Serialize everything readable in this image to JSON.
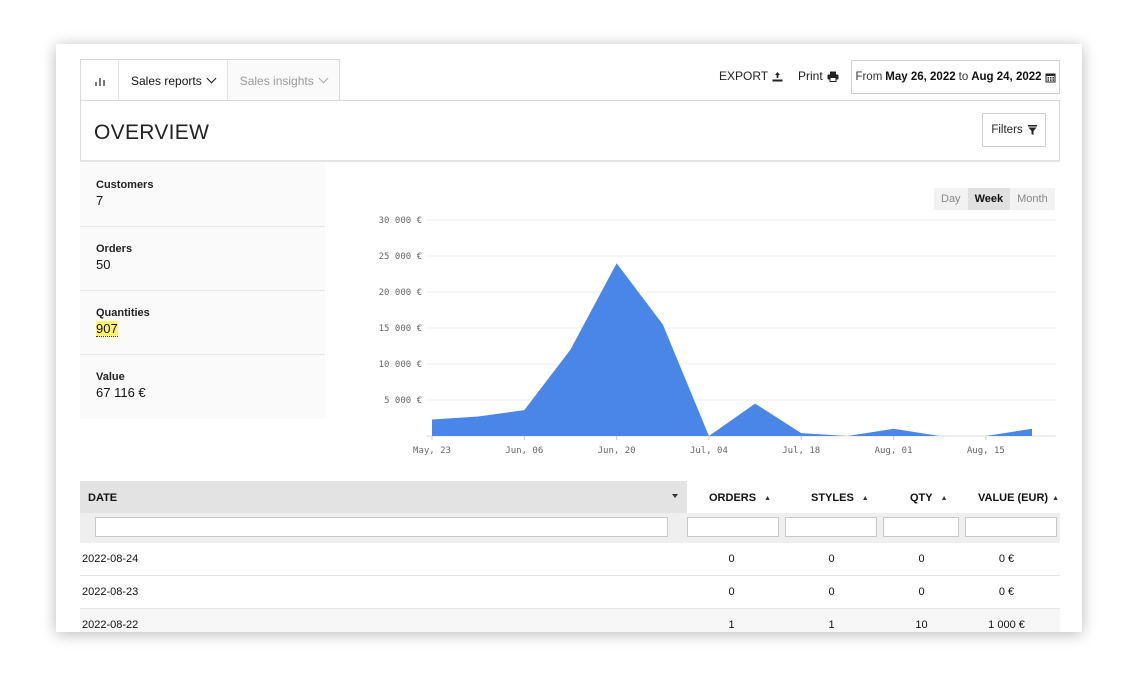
{
  "tabs": {
    "sales_reports": "Sales reports",
    "sales_insights": "Sales insights"
  },
  "toolbar": {
    "export": "EXPORT",
    "print": "Print"
  },
  "daterange": {
    "from_label": "From",
    "from": "May 26, 2022",
    "to_label": "to",
    "to": "Aug 24, 2022"
  },
  "overview": {
    "title": "OVERVIEW",
    "filters": "Filters"
  },
  "stats": [
    {
      "label": "Customers",
      "value": "7"
    },
    {
      "label": "Orders",
      "value": "50"
    },
    {
      "label": "Quantities",
      "value": "907"
    },
    {
      "label": "Value",
      "value": "67 116 €"
    }
  ],
  "period": {
    "day": "Day",
    "week": "Week",
    "month": "Month",
    "selected": "Week"
  },
  "colors": {
    "area": "#4a86e8",
    "grid": "#eeeeee"
  },
  "chart_data": {
    "type": "area",
    "x": [
      "May, 23",
      "May, 30",
      "Jun, 06",
      "Jun, 13",
      "Jun, 20",
      "Jun, 27",
      "Jul, 04",
      "Jul, 11",
      "Jul, 18",
      "Jul, 25",
      "Aug, 01",
      "Aug, 08",
      "Aug, 15",
      "Aug, 22"
    ],
    "xtick_labels": [
      "May, 23",
      "Jun, 06",
      "Jun, 20",
      "Jul, 04",
      "Jul, 18",
      "Aug, 01",
      "Aug, 15"
    ],
    "series": [
      {
        "values": [
          2300,
          2700,
          3600,
          12000,
          24000,
          15500,
          0,
          4500,
          400,
          0,
          1000,
          0,
          0,
          1000
        ]
      }
    ],
    "ylim": [
      0,
      30000
    ],
    "yticks": [
      5000,
      10000,
      15000,
      20000,
      25000,
      30000
    ],
    "ytick_labels": [
      "5 000 €",
      "10 000 €",
      "15 000 €",
      "20 000 €",
      "25 000 €",
      "30 000 €"
    ],
    "grid": true
  },
  "table": {
    "headers": {
      "date": "DATE",
      "orders": "ORDERS",
      "styles": "STYLES",
      "qty": "QTY",
      "value": "VALUE (EUR)"
    },
    "rows": [
      {
        "date": "2022-08-24",
        "orders": "0",
        "styles": "0",
        "qty": "0",
        "value": "0 €"
      },
      {
        "date": "2022-08-23",
        "orders": "0",
        "styles": "0",
        "qty": "0",
        "value": "0 €"
      },
      {
        "date": "2022-08-22",
        "orders": "1",
        "styles": "1",
        "qty": "10",
        "value": "1 000 €"
      }
    ]
  }
}
